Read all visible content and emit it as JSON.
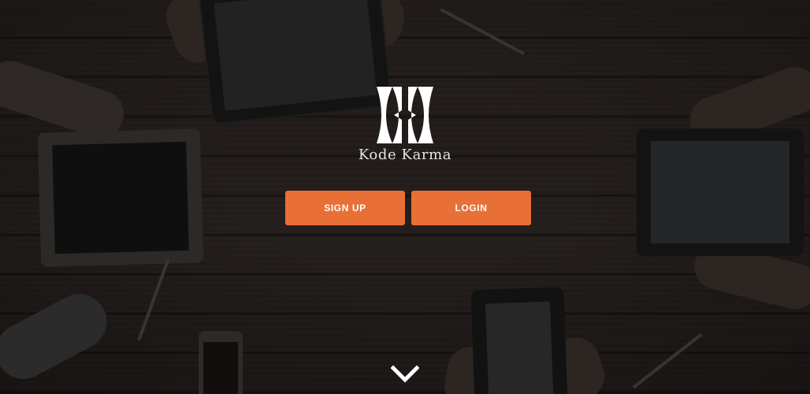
{
  "brand": {
    "name": "Kode Karma",
    "logo_icon": "kk-logo-icon"
  },
  "actions": {
    "signup_label": "SIGN UP",
    "login_label": "LOGIN"
  },
  "navigation": {
    "scroll_icon": "chevron-down-icon"
  },
  "colors": {
    "accent": "#e86f35",
    "text": "#e8e6e4",
    "background": "#2a2422"
  }
}
